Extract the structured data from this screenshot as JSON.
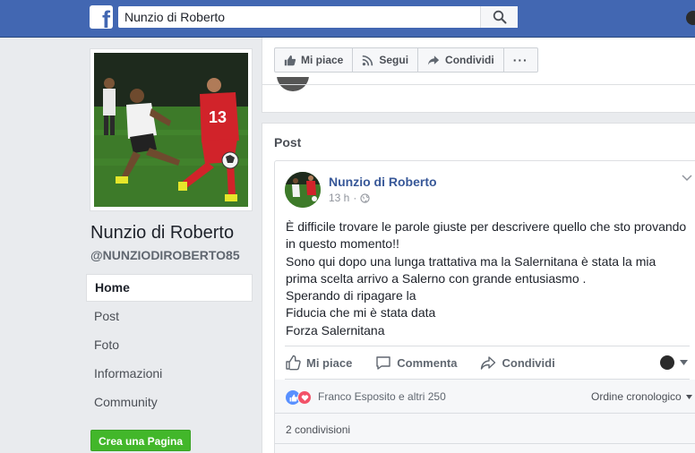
{
  "topbar": {
    "logo": "f",
    "search_value": "Nunzio di Roberto",
    "search_icon": "search-icon",
    "brand_color": "#4267b2"
  },
  "sidebar": {
    "page_name": "Nunzio di Roberto",
    "handle": "@NUNZIODIROBERTO85",
    "nav": [
      {
        "label": "Home",
        "active": true
      },
      {
        "label": "Post"
      },
      {
        "label": "Foto"
      },
      {
        "label": "Informazioni"
      },
      {
        "label": "Community"
      }
    ],
    "create_page": "Crea una Pagina"
  },
  "page_actions": {
    "like": "Mi piace",
    "follow": "Segui",
    "share": "Condividi",
    "more": "···"
  },
  "posts_section": {
    "heading": "Post",
    "post": {
      "author": "Nunzio di Roberto",
      "time": "13 h",
      "separator": "·",
      "text_lines": [
        "È difficile trovare le parole giuste per descrivere quello che sto provando",
        "in questo momento!!",
        "Sono qui dopo una lunga trattativa ma la Salernitana è stata la mia",
        "prima scelta arrivo a Salerno con grande entusiasmo .",
        "Sperando di ripagare la",
        "Fiducia che mi è stata data",
        "Forza Salernitana"
      ],
      "actions": {
        "like": "Mi piace",
        "comment": "Commenta",
        "share": "Condividi"
      },
      "reactions_text": "Franco Esposito e altri 250",
      "order_label": "Ordine cronologico",
      "shares_text": "2 condivisioni"
    }
  }
}
